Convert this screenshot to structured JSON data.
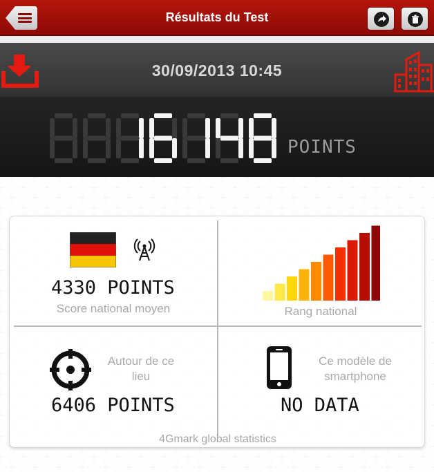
{
  "header": {
    "title": "Résultats du Test",
    "back_icon": "menu-back-icon",
    "share_icon": "share-icon",
    "delete_icon": "trash-icon",
    "accent_color": "#a8110a"
  },
  "test": {
    "datetime": "30/09/2013 10:45",
    "score": "16148",
    "score_unit": "POINTS"
  },
  "stats": {
    "national": {
      "points": "4330 POINTS",
      "label": "Score national moyen",
      "flag_icon": "germany-flag-icon",
      "network_icon": "antenna-icon"
    },
    "rank": {
      "label": "Rang national",
      "rank_icon": "rank-bars-icon"
    },
    "location": {
      "label_line1": "Autour de ce",
      "label_line2": "lieu",
      "points": "6406 POINTS",
      "icon": "target-icon"
    },
    "model": {
      "label_line1": "Ce modèle de",
      "label_line2": "smartphone",
      "value": "NO DATA",
      "icon": "smartphone-icon"
    },
    "footer": "4Gmark global statistics"
  }
}
